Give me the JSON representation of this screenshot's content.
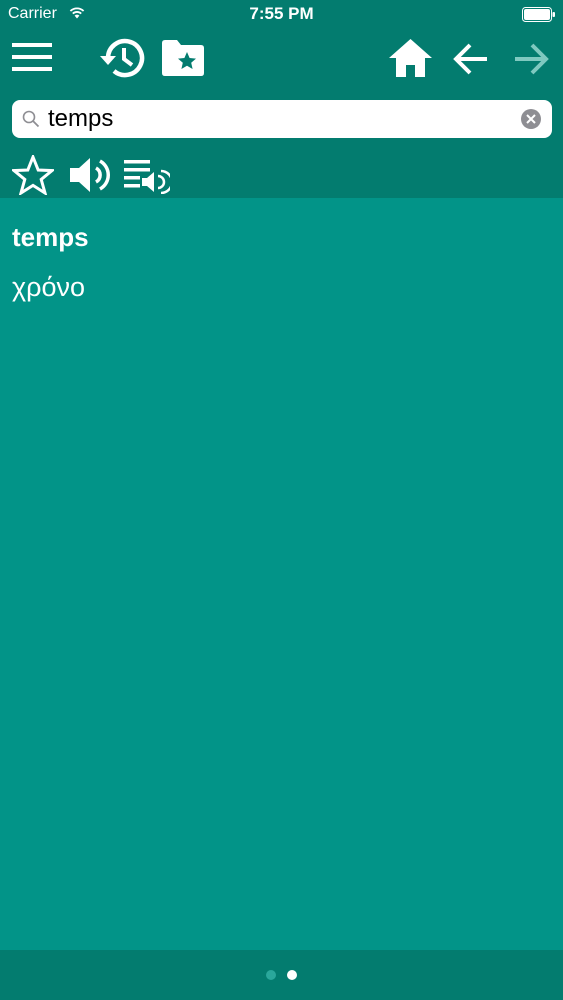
{
  "status": {
    "carrier": "Carrier",
    "time": "7:55 PM"
  },
  "toolbar": {
    "icons": [
      "menu-icon",
      "history-icon",
      "favorites-folder-icon",
      "home-icon",
      "back-arrow-icon",
      "forward-arrow-icon"
    ]
  },
  "search": {
    "value": "temps",
    "placeholder": ""
  },
  "actions": {
    "icons": [
      "star-icon",
      "speaker-icon",
      "playlist-audio-icon"
    ]
  },
  "entry": {
    "word": "temps",
    "translation": "χρόνο"
  },
  "pager": {
    "page_count": 2,
    "current_page": 2
  },
  "colors": {
    "background": "#029488",
    "bar": "#037c6f",
    "text": "#ffffff",
    "disabled_icon": "#7fc9c0"
  }
}
